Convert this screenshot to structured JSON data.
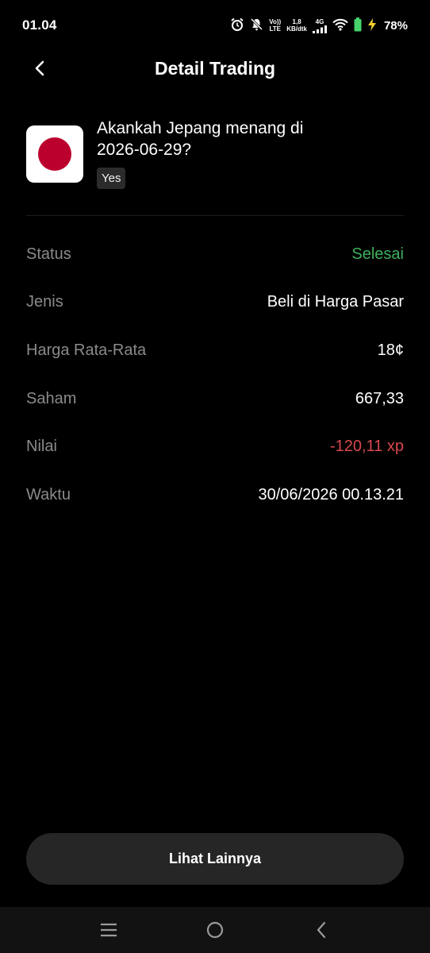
{
  "status_bar": {
    "time": "01.04",
    "volte_top": "Vo))",
    "volte_bottom": "LTE",
    "speed_value": "1,8",
    "speed_unit": "KB/dtk",
    "network": "4G",
    "battery_percent": "78%"
  },
  "header": {
    "title": "Detail Trading"
  },
  "market": {
    "question": "Akankah Jepang menang di 2026-06-29?",
    "outcome": "Yes",
    "flag_colors": {
      "background": "#ffffff",
      "circle": "#bc002d"
    }
  },
  "details": {
    "rows": [
      {
        "label": "Status",
        "value": "Selesai",
        "color": "#3fae5c"
      },
      {
        "label": "Jenis",
        "value": "Beli di Harga Pasar",
        "color": "#ffffff"
      },
      {
        "label": "Harga Rata-Rata",
        "value": "18¢",
        "color": "#ffffff"
      },
      {
        "label": "Saham",
        "value": "667,33",
        "color": "#ffffff"
      },
      {
        "label": "Nilai",
        "value": "-120,11 xp",
        "color": "#d9484f"
      },
      {
        "label": "Waktu",
        "value": "30/06/2026 00.13.21",
        "color": "#ffffff"
      }
    ]
  },
  "actions": {
    "more_label": "Lihat Lainnya"
  },
  "navigation": {
    "icons": [
      "menu-icon",
      "home-circle-icon",
      "back-chevron-icon"
    ]
  }
}
